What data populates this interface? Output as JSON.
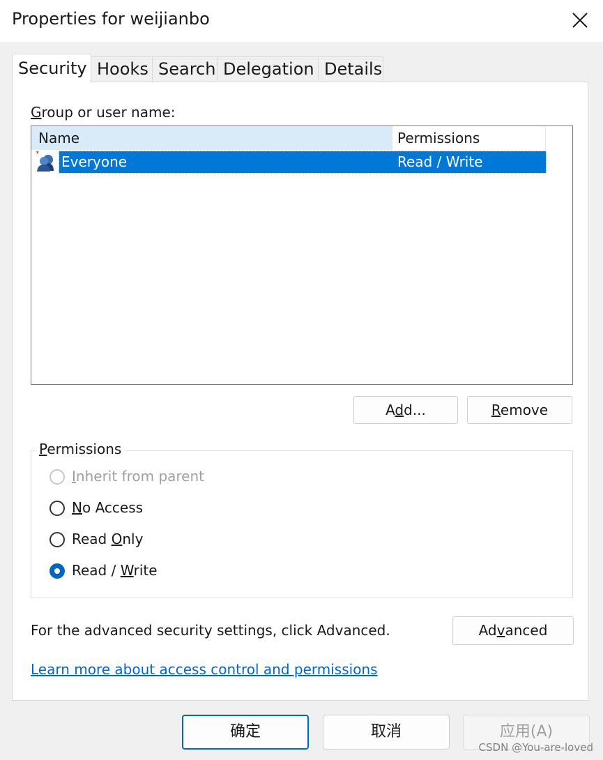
{
  "window": {
    "title": "Properties for weijianbo",
    "close_icon": "close-icon"
  },
  "tabs": [
    {
      "label": "Security",
      "active": true
    },
    {
      "label": "Hooks",
      "active": false
    },
    {
      "label": "Search",
      "active": false
    },
    {
      "label": "Delegation",
      "active": false
    },
    {
      "label": "Details",
      "active": false
    }
  ],
  "security": {
    "group_label_prefix": "G",
    "group_label_rest": "roup or user name:",
    "list": {
      "columns": [
        "Name",
        "Permissions"
      ],
      "rows": [
        {
          "name": "Everyone",
          "permissions": "Read / Write",
          "selected": true,
          "icon": "user-group-icon"
        }
      ]
    },
    "add_button": {
      "pre": "A",
      "under": "d",
      "post": "d..."
    },
    "remove_button": {
      "pre": "",
      "under": "R",
      "post": "emove"
    },
    "permissions_group": {
      "title_under": "P",
      "title_rest": "ermissions",
      "options": [
        {
          "pre": "",
          "under": "I",
          "post": "nherit from parent",
          "checked": false,
          "disabled": true
        },
        {
          "pre": "",
          "under": "N",
          "post": "o Access",
          "checked": false,
          "disabled": false
        },
        {
          "pre": "Read ",
          "under": "O",
          "post": "nly",
          "checked": false,
          "disabled": false
        },
        {
          "pre": "Read / ",
          "under": "W",
          "post": "rite",
          "checked": true,
          "disabled": false
        }
      ]
    },
    "advanced_text": "For the advanced security settings, click Advanced.",
    "advanced_button": {
      "pre": "Ad",
      "under": "v",
      "post": "anced"
    },
    "learn_more_link": "Learn more about access control and permissions"
  },
  "footer": {
    "ok_label": "确定",
    "cancel_label": "取消",
    "apply_label": "应用(A)"
  },
  "watermark": "CSDN @You-are-loved",
  "colors": {
    "accent": "#0078d7",
    "header_highlight": "#d9ebf9",
    "link": "#0066cc"
  }
}
